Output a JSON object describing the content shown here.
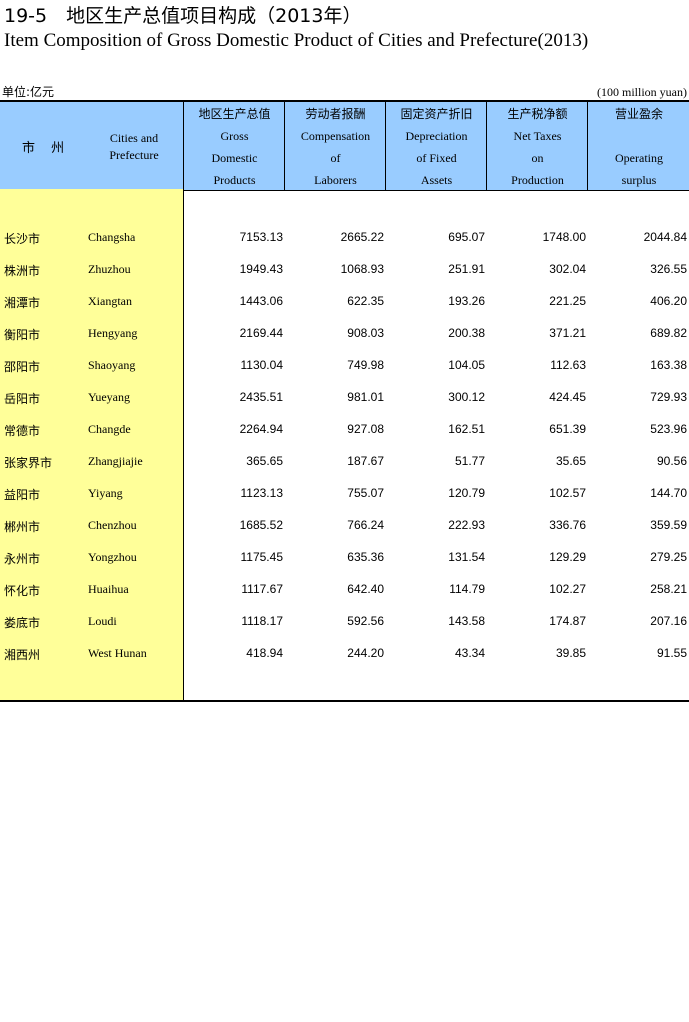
{
  "title": {
    "cn": "19-5　地区生产总值项目构成（2013年）",
    "en": "Item Composition of Gross Domestic Product of Cities and Prefecture(2013)"
  },
  "unit": {
    "cn": "单位:亿元",
    "en": "(100 million yuan)"
  },
  "header": {
    "city_cn": "市 州",
    "city_en": [
      "Cities and",
      "Prefecture"
    ],
    "columns": [
      {
        "cn": "地区生产总值",
        "en": [
          "Gross",
          "Domestic",
          "Products"
        ]
      },
      {
        "cn": "劳动者报酬",
        "en": [
          "Compensation",
          "of",
          "Laborers"
        ]
      },
      {
        "cn": "固定资产折旧",
        "en": [
          "Depreciation",
          "of Fixed",
          "Assets"
        ]
      },
      {
        "cn": "生产税净额",
        "en": [
          "Net Taxes",
          "on",
          "Production"
        ]
      },
      {
        "cn": "营业盈余",
        "en": [
          "",
          "Operating",
          "surplus"
        ]
      }
    ]
  },
  "rows": [
    {
      "cn": "长沙市",
      "en": "Changsha",
      "v": [
        "7153.13",
        "2665.22",
        "695.07",
        "1748.00",
        "2044.84"
      ]
    },
    {
      "cn": "株洲市",
      "en": "Zhuzhou",
      "v": [
        "1949.43",
        "1068.93",
        "251.91",
        "302.04",
        "326.55"
      ]
    },
    {
      "cn": "湘潭市",
      "en": "Xiangtan",
      "v": [
        "1443.06",
        "622.35",
        "193.26",
        "221.25",
        "406.20"
      ]
    },
    {
      "cn": "衡阳市",
      "en": "Hengyang",
      "v": [
        "2169.44",
        "908.03",
        "200.38",
        "371.21",
        "689.82"
      ]
    },
    {
      "cn": "邵阳市",
      "en": "Shaoyang",
      "v": [
        "1130.04",
        "749.98",
        "104.05",
        "112.63",
        "163.38"
      ]
    },
    {
      "cn": "岳阳市",
      "en": "Yueyang",
      "v": [
        "2435.51",
        "981.01",
        "300.12",
        "424.45",
        "729.93"
      ]
    },
    {
      "cn": "常德市",
      "en": "Changde",
      "v": [
        "2264.94",
        "927.08",
        "162.51",
        "651.39",
        "523.96"
      ]
    },
    {
      "cn": "张家界市",
      "en": "Zhangjiajie",
      "v": [
        "365.65",
        "187.67",
        "51.77",
        "35.65",
        "90.56"
      ]
    },
    {
      "cn": "益阳市",
      "en": "Yiyang",
      "v": [
        "1123.13",
        "755.07",
        "120.79",
        "102.57",
        "144.70"
      ]
    },
    {
      "cn": "郴州市",
      "en": "Chenzhou",
      "v": [
        "1685.52",
        "766.24",
        "222.93",
        "336.76",
        "359.59"
      ]
    },
    {
      "cn": "永州市",
      "en": "Yongzhou",
      "v": [
        "1175.45",
        "635.36",
        "131.54",
        "129.29",
        "279.25"
      ]
    },
    {
      "cn": "怀化市",
      "en": "Huaihua",
      "v": [
        "1117.67",
        "642.40",
        "114.79",
        "102.27",
        "258.21"
      ]
    },
    {
      "cn": "娄底市",
      "en": "Loudi",
      "v": [
        "1118.17",
        "592.56",
        "143.58",
        "174.87",
        "207.16"
      ]
    },
    {
      "cn": "湘西州",
      "en": "West Hunan",
      "v": [
        "418.94",
        "244.20",
        "43.34",
        "39.85",
        "91.55"
      ]
    }
  ]
}
